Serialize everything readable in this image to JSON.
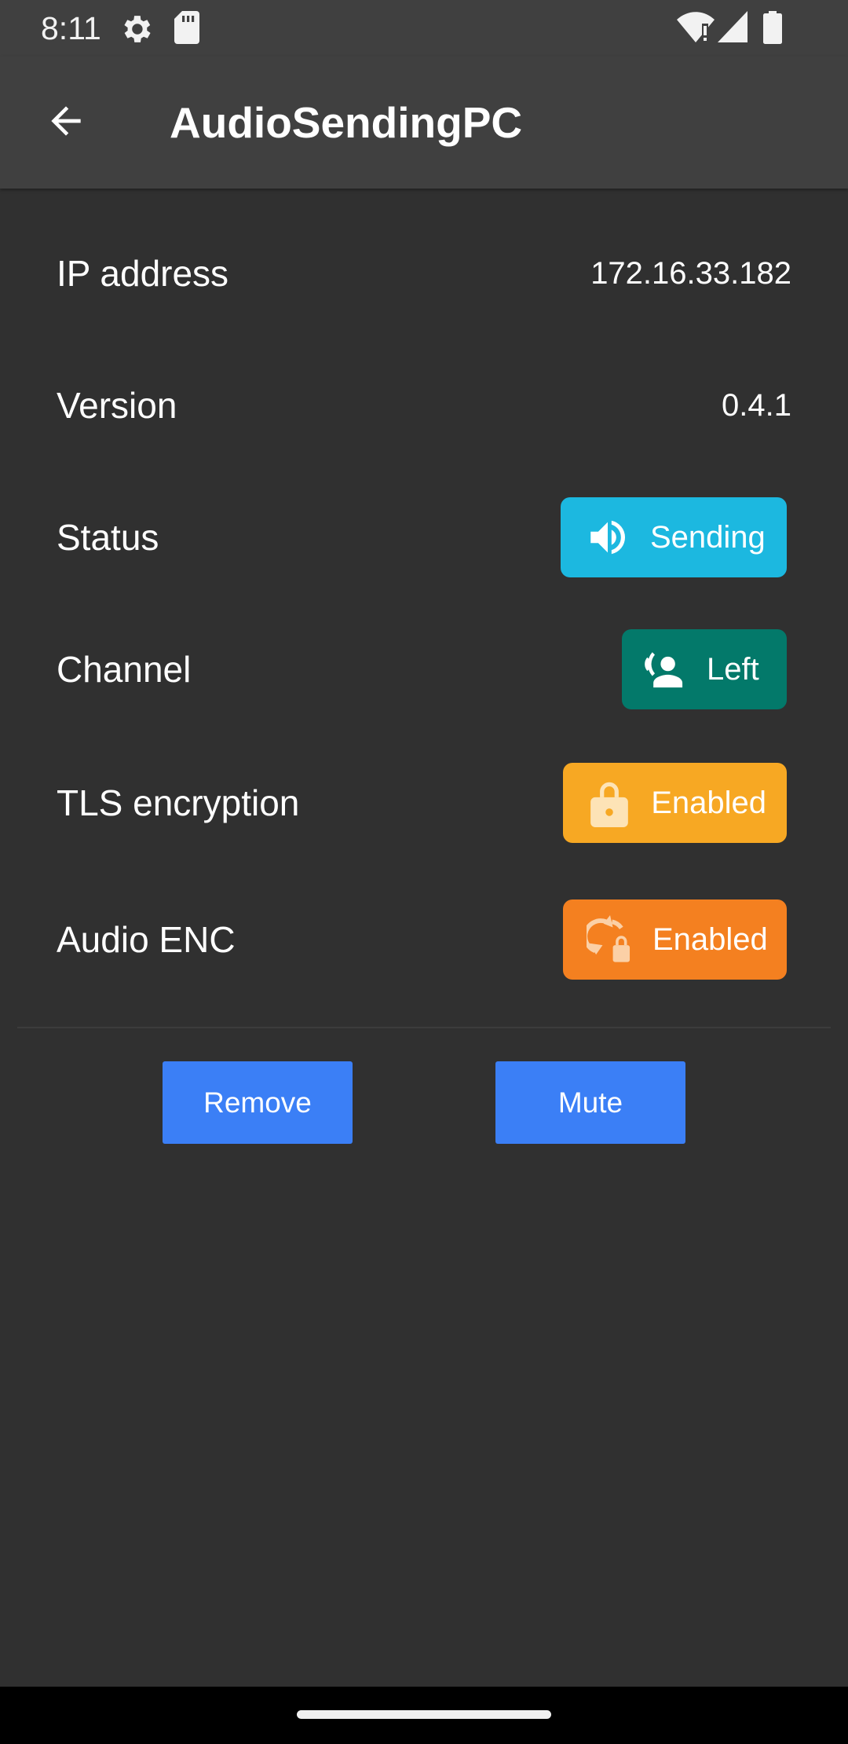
{
  "status_bar": {
    "time": "8:11",
    "icons": [
      "settings-gear-icon",
      "sd-card-icon",
      "wifi-alert-icon",
      "cell-signal-icon",
      "battery-icon"
    ]
  },
  "app_bar": {
    "back_icon": "arrow-back-icon",
    "title": "AudioSendingPC"
  },
  "details": {
    "ip_address": {
      "label": "IP address",
      "value": "172.16.33.182"
    },
    "version": {
      "label": "Version",
      "value": "0.4.1"
    },
    "status": {
      "label": "Status",
      "value": "Sending",
      "icon": "volume-icon",
      "color": "#1cb8e0"
    },
    "channel": {
      "label": "Channel",
      "value": "Left",
      "icon": "person-voice-icon",
      "color": "#03796a"
    },
    "tls": {
      "label": "TLS encryption",
      "value": "Enabled",
      "icon": "lock-icon",
      "color": "#f7a823"
    },
    "audio_enc": {
      "label": "Audio ENC",
      "value": "Enabled",
      "icon": "lock-refresh-icon",
      "color": "#f48020"
    }
  },
  "actions": {
    "remove_label": "Remove",
    "mute_label": "Mute",
    "color": "#3b7ff6"
  }
}
